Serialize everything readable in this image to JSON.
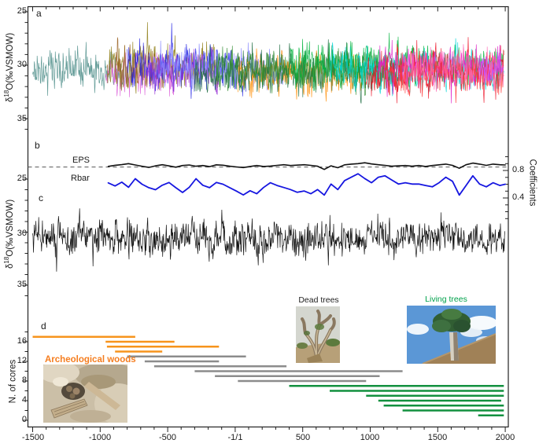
{
  "labels": {
    "panel_a": "a",
    "panel_b": "b",
    "panel_c": "c",
    "panel_d": "d",
    "eps": "EPS",
    "rbar": "Rbar",
    "dead_trees": "Dead trees",
    "living_trees": "Living trees",
    "archeological_woods": "Archeological woods"
  },
  "axes": {
    "x_ticks": [
      "-1500",
      "-1000",
      "-500",
      "-1/1",
      "500",
      "1000",
      "1500",
      "2000"
    ],
    "panel_a_yticks": [
      "25",
      "30",
      "35"
    ],
    "panel_c_yticks": [
      "25",
      "30",
      "35"
    ],
    "panel_d_yticks": [
      "16",
      "12",
      "8",
      "4",
      "0"
    ],
    "right_yticks": [
      "0.8",
      "0.4"
    ],
    "ylabel_delta": "δ",
    "ylabel_sup": "18",
    "ylabel_rest": "O(‰VSMOW)",
    "ylabel_d": "N. of cores",
    "ylabel_right": "Coefficients"
  },
  "colors": {
    "archeological": "#F7941D",
    "dead": "#8C8C8C",
    "living": "#12903F",
    "living_text": "#00A14B",
    "archeo_text": "#F57E20",
    "eps_line": "#111111",
    "rbar_line": "#1616E0",
    "threshold_dash": "#555555"
  },
  "chart_data": [
    {
      "panel": "a",
      "type": "line",
      "ylabel": "δ18O(‰VSMOW)",
      "yticks": [
        25,
        30,
        35
      ],
      "ylim": [
        35,
        25
      ],
      "xlim": [
        -1500,
        2000
      ],
      "description": "17 overlapping noisy tree-ring d18O core series, one per coverage bar of panel d",
      "series": [
        {
          "name": "archeo-1",
          "color": "#4F8E8A",
          "start": -1500,
          "end": -740,
          "mean": 30.6,
          "amp": 1.5
        },
        {
          "name": "archeo-2",
          "color": "#DD62DB",
          "start": -960,
          "end": -450,
          "mean": 30.9,
          "amp": 1.6
        },
        {
          "name": "archeo-3",
          "color": "#8E7D14",
          "start": -950,
          "end": -120,
          "mean": 30.1,
          "amp": 1.7
        },
        {
          "name": "archeo-4",
          "color": "#975D1C",
          "start": -890,
          "end": -540,
          "mean": 30.0,
          "amp": 1.5
        },
        {
          "name": "dead-1",
          "color": "#2323E2",
          "start": -800,
          "end": 80,
          "mean": 30.3,
          "amp": 1.7
        },
        {
          "name": "dead-2",
          "color": "#9933D6",
          "start": -670,
          "end": -120,
          "mean": 30.5,
          "amp": 1.5
        },
        {
          "name": "dead-3",
          "color": "#8585FF",
          "start": -600,
          "end": 380,
          "mean": 30.2,
          "amp": 1.5
        },
        {
          "name": "dead-4",
          "color": "#FF8C00",
          "start": 20,
          "end": 970,
          "mean": 30.8,
          "amp": 1.6
        },
        {
          "name": "dead-5",
          "color": "#1E6C41",
          "start": -300,
          "end": 1240,
          "mean": 30.6,
          "amp": 1.6
        },
        {
          "name": "dead-6",
          "color": "#2F8B2F",
          "start": -150,
          "end": 1070,
          "mean": 30.4,
          "amp": 1.5
        },
        {
          "name": "living-1",
          "color": "#00B33C",
          "start": 400,
          "end": 1990,
          "mean": 30.0,
          "amp": 1.6
        },
        {
          "name": "living-2",
          "color": "#00D5D5",
          "start": 700,
          "end": 1990,
          "mean": 30.6,
          "amp": 1.5
        },
        {
          "name": "living-3",
          "color": "#EE1126",
          "start": 970,
          "end": 1990,
          "mean": 30.5,
          "amp": 1.6
        },
        {
          "name": "living-4",
          "color": "#E01FC8",
          "start": 1060,
          "end": 1970,
          "mean": 30.3,
          "amp": 1.5
        },
        {
          "name": "living-5",
          "color": "#FF3333",
          "start": 1100,
          "end": 1990,
          "mean": 30.7,
          "amp": 1.4
        },
        {
          "name": "living-6",
          "color": "#FF69B4",
          "start": 1240,
          "end": 1990,
          "mean": 30.4,
          "amp": 1.5
        },
        {
          "name": "living-7",
          "color": "#C44DFF",
          "start": 1800,
          "end": 1990,
          "mean": 30.2,
          "amp": 1.4
        }
      ]
    },
    {
      "panel": "b",
      "type": "line",
      "ylabel_right": "Coefficients",
      "right_ticks": [
        0.4,
        0.8
      ],
      "threshold": 0.85,
      "years": [
        -940,
        -890,
        -840,
        -790,
        -740,
        -690,
        -640,
        -590,
        -540,
        -490,
        -440,
        -390,
        -340,
        -290,
        -240,
        -190,
        -140,
        -90,
        -40,
        10,
        60,
        110,
        160,
        210,
        260,
        310,
        360,
        410,
        460,
        510,
        560,
        610,
        660,
        710,
        760,
        810,
        860,
        910,
        960,
        1010,
        1060,
        1110,
        1160,
        1210,
        1260,
        1310,
        1360,
        1410,
        1460,
        1510,
        1560,
        1610,
        1660,
        1710,
        1760,
        1810,
        1860,
        1910,
        1960,
        2000
      ],
      "series": [
        {
          "name": "EPS",
          "color": "#111111",
          "width": 1.6,
          "values": [
            0.86,
            0.875,
            0.885,
            0.9,
            0.88,
            0.862,
            0.845,
            0.868,
            0.884,
            0.866,
            0.848,
            0.872,
            0.88,
            0.862,
            0.872,
            0.856,
            0.882,
            0.876,
            0.862,
            0.852,
            0.842,
            0.858,
            0.872,
            0.858,
            0.864,
            0.874,
            0.884,
            0.872,
            0.878,
            0.884,
            0.874,
            0.862,
            0.815,
            0.868,
            0.84,
            0.882,
            0.892,
            0.9,
            0.912,
            0.895,
            0.884,
            0.874,
            0.862,
            0.868,
            0.872,
            0.862,
            0.872,
            0.858,
            0.872,
            0.882,
            0.892,
            0.874,
            0.832,
            0.884,
            0.908,
            0.892,
            0.874,
            0.892,
            0.884,
            0.88
          ]
        },
        {
          "name": "Rbar",
          "color": "#1616E0",
          "width": 1.8,
          "values": [
            0.62,
            0.575,
            0.63,
            0.555,
            0.68,
            0.6,
            0.55,
            0.52,
            0.585,
            0.625,
            0.55,
            0.48,
            0.555,
            0.68,
            0.585,
            0.55,
            0.625,
            0.6,
            0.55,
            0.5,
            0.445,
            0.505,
            0.462,
            0.552,
            0.622,
            0.582,
            0.552,
            0.522,
            0.482,
            0.502,
            0.462,
            0.522,
            0.442,
            0.602,
            0.522,
            0.652,
            0.702,
            0.752,
            0.682,
            0.622,
            0.702,
            0.722,
            0.662,
            0.602,
            0.622,
            0.602,
            0.602,
            0.582,
            0.562,
            0.622,
            0.702,
            0.642,
            0.442,
            0.582,
            0.722,
            0.602,
            0.562,
            0.622,
            0.582,
            0.6
          ]
        }
      ]
    },
    {
      "panel": "c",
      "type": "line",
      "ylabel": "δ18O(‰VSMOW)",
      "yticks": [
        25,
        30,
        35
      ],
      "ylim": [
        35,
        25
      ],
      "description": "composite d18O chronology, single black noisy series spanning full record",
      "series": [
        {
          "name": "composite",
          "color": "#141414",
          "start": -1500,
          "end": 2000,
          "mean": 30.6,
          "amp": 1.35
        }
      ]
    },
    {
      "panel": "d",
      "type": "gantt-bars",
      "ylabel": "N. of cores",
      "yticks": [
        0,
        4,
        8,
        12,
        16
      ],
      "xlim": [
        -1500,
        2000
      ],
      "rows": [
        {
          "group": "Archeological woods",
          "color": "#F7941D",
          "n": 17,
          "start": -1500,
          "end": -740
        },
        {
          "group": "Archeological woods",
          "color": "#F7941D",
          "n": 16,
          "start": -960,
          "end": -450
        },
        {
          "group": "Archeological woods",
          "color": "#F7941D",
          "n": 15,
          "start": -950,
          "end": -120
        },
        {
          "group": "Archeological woods",
          "color": "#F7941D",
          "n": 14,
          "start": -890,
          "end": -540
        },
        {
          "group": "Dead trees",
          "color": "#8C8C8C",
          "n": 13,
          "start": -800,
          "end": 80
        },
        {
          "group": "Dead trees",
          "color": "#8C8C8C",
          "n": 12,
          "start": -670,
          "end": -120
        },
        {
          "group": "Dead trees",
          "color": "#8C8C8C",
          "n": 11,
          "start": -600,
          "end": 380
        },
        {
          "group": "Dead trees",
          "color": "#8C8C8C",
          "n": 10,
          "start": -300,
          "end": 1240
        },
        {
          "group": "Dead trees",
          "color": "#8C8C8C",
          "n": 9,
          "start": -150,
          "end": 1070
        },
        {
          "group": "Dead trees",
          "color": "#8C8C8C",
          "n": 8,
          "start": 20,
          "end": 970
        },
        {
          "group": "Living trees",
          "color": "#12903F",
          "n": 7,
          "start": 400,
          "end": 1990
        },
        {
          "group": "Living trees",
          "color": "#12903F",
          "n": 6,
          "start": 700,
          "end": 1990
        },
        {
          "group": "Living trees",
          "color": "#12903F",
          "n": 5,
          "start": 970,
          "end": 1990
        },
        {
          "group": "Living trees",
          "color": "#12903F",
          "n": 4,
          "start": 1060,
          "end": 1970
        },
        {
          "group": "Living trees",
          "color": "#12903F",
          "n": 3,
          "start": 1100,
          "end": 1990
        },
        {
          "group": "Living trees",
          "color": "#12903F",
          "n": 2,
          "start": 1240,
          "end": 1990
        },
        {
          "group": "Living trees",
          "color": "#12903F",
          "n": 1,
          "start": 1800,
          "end": 1990
        }
      ]
    }
  ]
}
